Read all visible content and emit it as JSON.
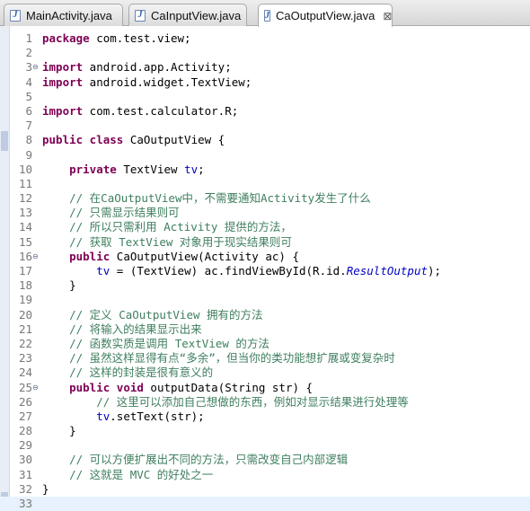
{
  "tabs": [
    {
      "label": "MainActivity.java",
      "icon": "java-file-icon",
      "active": false
    },
    {
      "label": "CaInputView.java",
      "icon": "java-file-icon",
      "active": false
    },
    {
      "label": "CaOutputView.java",
      "icon": "java-file-icon",
      "active": true,
      "close": "⊠"
    }
  ],
  "file_icon_letter": "J",
  "lines": [
    {
      "n": "1",
      "tokens": [
        [
          "kw",
          "package"
        ],
        [
          "t",
          " com.test.view;"
        ]
      ]
    },
    {
      "n": "2",
      "tokens": []
    },
    {
      "n": "3",
      "fold": "⊖",
      "tokens": [
        [
          "kw",
          "import"
        ],
        [
          "t",
          " android.app.Activity;"
        ]
      ]
    },
    {
      "n": "4",
      "tokens": [
        [
          "kw",
          "import"
        ],
        [
          "t",
          " android.widget.TextView;"
        ]
      ]
    },
    {
      "n": "5",
      "tokens": []
    },
    {
      "n": "6",
      "tokens": [
        [
          "kw",
          "import"
        ],
        [
          "t",
          " com.test.calculator.R;"
        ]
      ]
    },
    {
      "n": "7",
      "tokens": []
    },
    {
      "n": "8",
      "tokens": [
        [
          "kw",
          "public class"
        ],
        [
          "t",
          " CaOutputView {"
        ]
      ]
    },
    {
      "n": "9",
      "tokens": []
    },
    {
      "n": "10",
      "tokens": [
        [
          "t",
          "    "
        ],
        [
          "kw",
          "private"
        ],
        [
          "t",
          " TextView "
        ],
        [
          "fld",
          "tv"
        ],
        [
          "t",
          ";"
        ]
      ]
    },
    {
      "n": "11",
      "tokens": []
    },
    {
      "n": "12",
      "tokens": [
        [
          "cm",
          "    // 在CaOutputView中，不需要通知Activity发生了什么"
        ]
      ]
    },
    {
      "n": "13",
      "tokens": [
        [
          "cm",
          "    // 只需显示结果则可"
        ]
      ]
    },
    {
      "n": "14",
      "tokens": [
        [
          "cm",
          "    // 所以只需利用 Activity 提供的方法，"
        ]
      ]
    },
    {
      "n": "15",
      "tokens": [
        [
          "cm",
          "    // 获取 TextView 对象用于现实结果则可"
        ]
      ]
    },
    {
      "n": "16",
      "fold": "⊖",
      "tokens": [
        [
          "t",
          "    "
        ],
        [
          "kw",
          "public"
        ],
        [
          "t",
          " CaOutputView(Activity ac) {"
        ]
      ]
    },
    {
      "n": "17",
      "tokens": [
        [
          "t",
          "        "
        ],
        [
          "fld",
          "tv"
        ],
        [
          "t",
          " = (TextView) ac.findViewById(R.id."
        ],
        [
          "st",
          "ResultOutput"
        ],
        [
          "t",
          ");"
        ]
      ]
    },
    {
      "n": "18",
      "tokens": [
        [
          "t",
          "    }"
        ]
      ]
    },
    {
      "n": "19",
      "tokens": []
    },
    {
      "n": "20",
      "tokens": [
        [
          "cm",
          "    // 定义 CaOutputView 拥有的方法"
        ]
      ]
    },
    {
      "n": "21",
      "tokens": [
        [
          "cm",
          "    // 将输入的结果显示出来"
        ]
      ]
    },
    {
      "n": "22",
      "tokens": [
        [
          "cm",
          "    // 函数实质是调用 TextView 的方法"
        ]
      ]
    },
    {
      "n": "23",
      "tokens": [
        [
          "cm",
          "    // 虽然这样显得有点“多余”，但当你的类功能想扩展或变复杂时"
        ]
      ]
    },
    {
      "n": "24",
      "tokens": [
        [
          "cm",
          "    // 这样的封装是很有意义的"
        ]
      ]
    },
    {
      "n": "25",
      "fold": "⊖",
      "tokens": [
        [
          "t",
          "    "
        ],
        [
          "kw",
          "public void"
        ],
        [
          "t",
          " outputData(String str) {"
        ]
      ]
    },
    {
      "n": "26",
      "tokens": [
        [
          "cm",
          "        // 这里可以添加自己想做的东西，例如对显示结果进行处理等"
        ]
      ]
    },
    {
      "n": "27",
      "tokens": [
        [
          "t",
          "        "
        ],
        [
          "fld",
          "tv"
        ],
        [
          "t",
          ".setText(str);"
        ]
      ]
    },
    {
      "n": "28",
      "tokens": [
        [
          "t",
          "    }"
        ]
      ]
    },
    {
      "n": "29",
      "tokens": []
    },
    {
      "n": "30",
      "tokens": [
        [
          "cm",
          "    // 可以方便扩展出不同的方法，只需改变自己内部逻辑"
        ]
      ]
    },
    {
      "n": "31",
      "tokens": [
        [
          "cm",
          "    // 这就是 MVC 的好处之一"
        ]
      ]
    },
    {
      "n": "32",
      "tokens": [
        [
          "t",
          "}"
        ]
      ]
    },
    {
      "n": "33",
      "current": true,
      "tokens": []
    }
  ]
}
